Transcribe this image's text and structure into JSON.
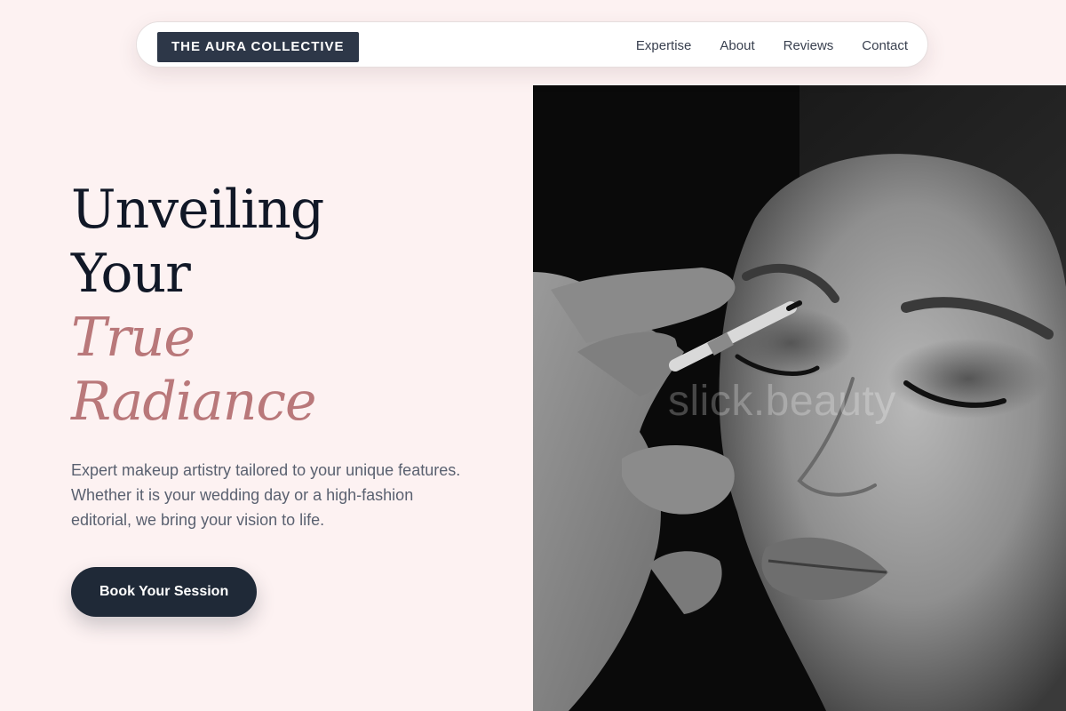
{
  "brand": {
    "logo_text": "THE AURA COLLECTIVE"
  },
  "nav": {
    "items": [
      {
        "label": "Expertise"
      },
      {
        "label": "About"
      },
      {
        "label": "Reviews"
      },
      {
        "label": "Contact"
      }
    ]
  },
  "hero": {
    "title_line1": "Unveiling",
    "title_line2": "Your",
    "title_accent1": "True",
    "title_accent2": "Radiance",
    "description": "Expert makeup artistry tailored to your unique features. Whether it is your wedding day or a high-fashion editorial, we bring your vision to life.",
    "cta_label": "Book Your Session",
    "image": {
      "watermark": "slick.beauty"
    }
  },
  "colors": {
    "background": "#fdf2f2",
    "heading": "#111827",
    "accent": "#b9787a",
    "button": "#1f2937",
    "logo_bg": "#2d3748"
  }
}
